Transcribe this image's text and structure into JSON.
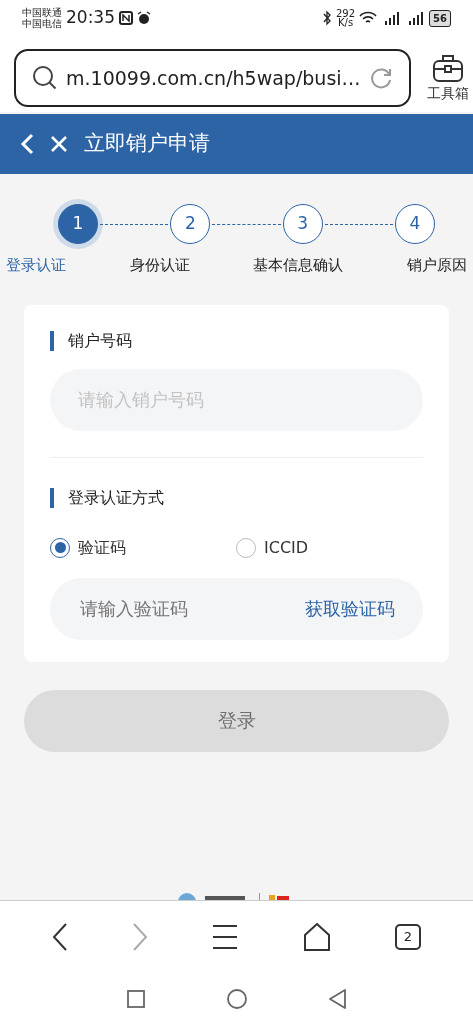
{
  "status_bar": {
    "carriers": [
      "中国联通",
      "中国电信"
    ],
    "time": "20:35",
    "speed": "292",
    "speed_unit": "K/s",
    "battery": "56"
  },
  "browser": {
    "url": "m.10099.com.cn/h5wap/busi…",
    "toolbox_label": "工具箱",
    "tab_count": "2",
    "forward_disabled": true
  },
  "header": {
    "title": "立即销户申请"
  },
  "steps": [
    {
      "number": "1",
      "label": "登录认证",
      "selected": true
    },
    {
      "number": "2",
      "label": "身份认证",
      "selected": false
    },
    {
      "number": "3",
      "label": "基本信息确认",
      "selected": false
    },
    {
      "number": "4",
      "label": "销户原因",
      "selected": false
    }
  ],
  "form": {
    "number_section": {
      "title": "销户号码",
      "placeholder": "请输入销户号码"
    },
    "auth_section": {
      "title": "登录认证方式",
      "options": [
        {
          "label": "验证码",
          "selected": true
        },
        {
          "label": "ICCID",
          "selected": false
        }
      ],
      "placeholder": "请输入验证码",
      "code_link": "获取验证码"
    }
  },
  "login_button": {
    "label": "登录",
    "disabled": true
  }
}
